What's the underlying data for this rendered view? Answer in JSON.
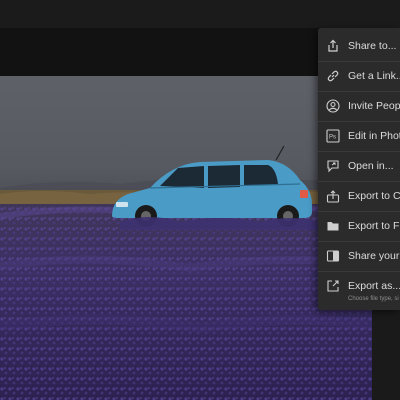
{
  "share_menu": {
    "items": [
      {
        "label": "Share to...",
        "icon": "share-icon"
      },
      {
        "label": "Get a Link...",
        "icon": "link-icon"
      },
      {
        "label": "Invite Peopl",
        "icon": "invite-people-icon"
      },
      {
        "label": "Edit in Photo",
        "icon": "photoshop-icon"
      },
      {
        "label": "Open in...",
        "icon": "open-in-icon"
      },
      {
        "label": "Export to Ca",
        "icon": "export-camera-roll-icon"
      },
      {
        "label": "Export to Fil",
        "icon": "folder-icon"
      },
      {
        "label": "Share your E",
        "icon": "share-edit-icon"
      },
      {
        "label": "Export as...",
        "sublabel": "Choose file type, si",
        "icon": "export-as-icon"
      }
    ]
  },
  "colors": {
    "menu_background": "#2b2b2b",
    "menu_text": "#dcdcdc",
    "car": "#4a9cc7",
    "lavender": "#4b3d7c"
  }
}
